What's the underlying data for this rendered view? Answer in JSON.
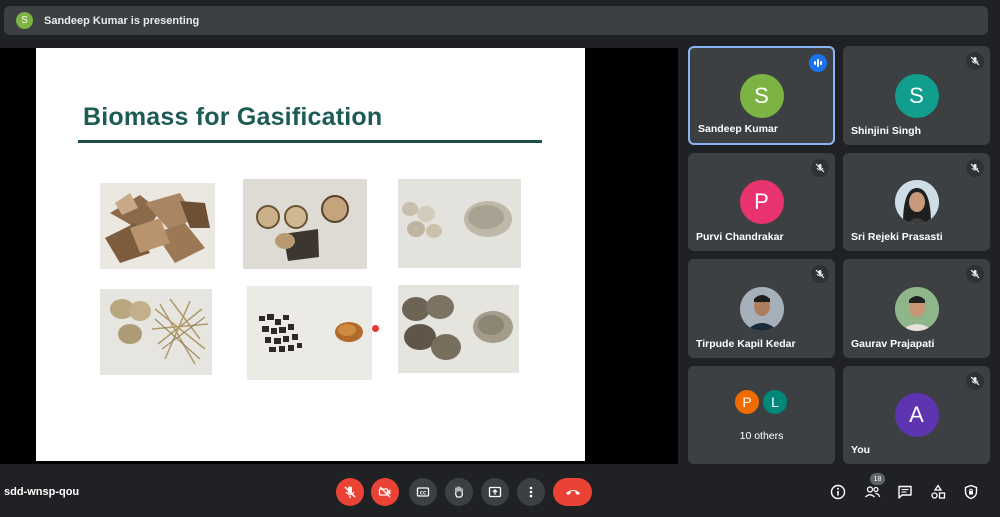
{
  "banner": {
    "avatar_letter": "S",
    "text": "Sandeep Kumar is presenting"
  },
  "slide": {
    "title": "Biomass for Gasification"
  },
  "participants": [
    {
      "name": "Sandeep Kumar",
      "letter": "S",
      "color": "#7cb342"
    },
    {
      "name": "Shinjini Singh",
      "letter": "S",
      "color": "#129e8f"
    },
    {
      "name": "Purvi Chandrakar",
      "letter": "P",
      "color": "#e8336f"
    },
    {
      "name": "Sri Rejeki Prasasti",
      "letter": "",
      "color": ""
    },
    {
      "name": "Tirpude Kapil Kedar",
      "letter": "",
      "color": ""
    },
    {
      "name": "Gaurav Prajapati",
      "letter": "",
      "color": ""
    },
    {
      "name": "You",
      "letter": "A",
      "color": "#5e35b1"
    }
  ],
  "others": {
    "label": "10 others",
    "letters": [
      "P",
      "L"
    ],
    "colors": [
      "#ef6c00",
      "#00897b"
    ]
  },
  "meeting_code": "sdd-wnsp-qou",
  "people_count": "18",
  "icons": [
    "mic-off-icon",
    "camera-off-icon",
    "captions-icon",
    "raise-hand-icon",
    "present-icon",
    "more-icon",
    "hang-up-icon",
    "info-icon",
    "people-icon",
    "chat-icon",
    "activities-icon",
    "host-controls-icon"
  ]
}
